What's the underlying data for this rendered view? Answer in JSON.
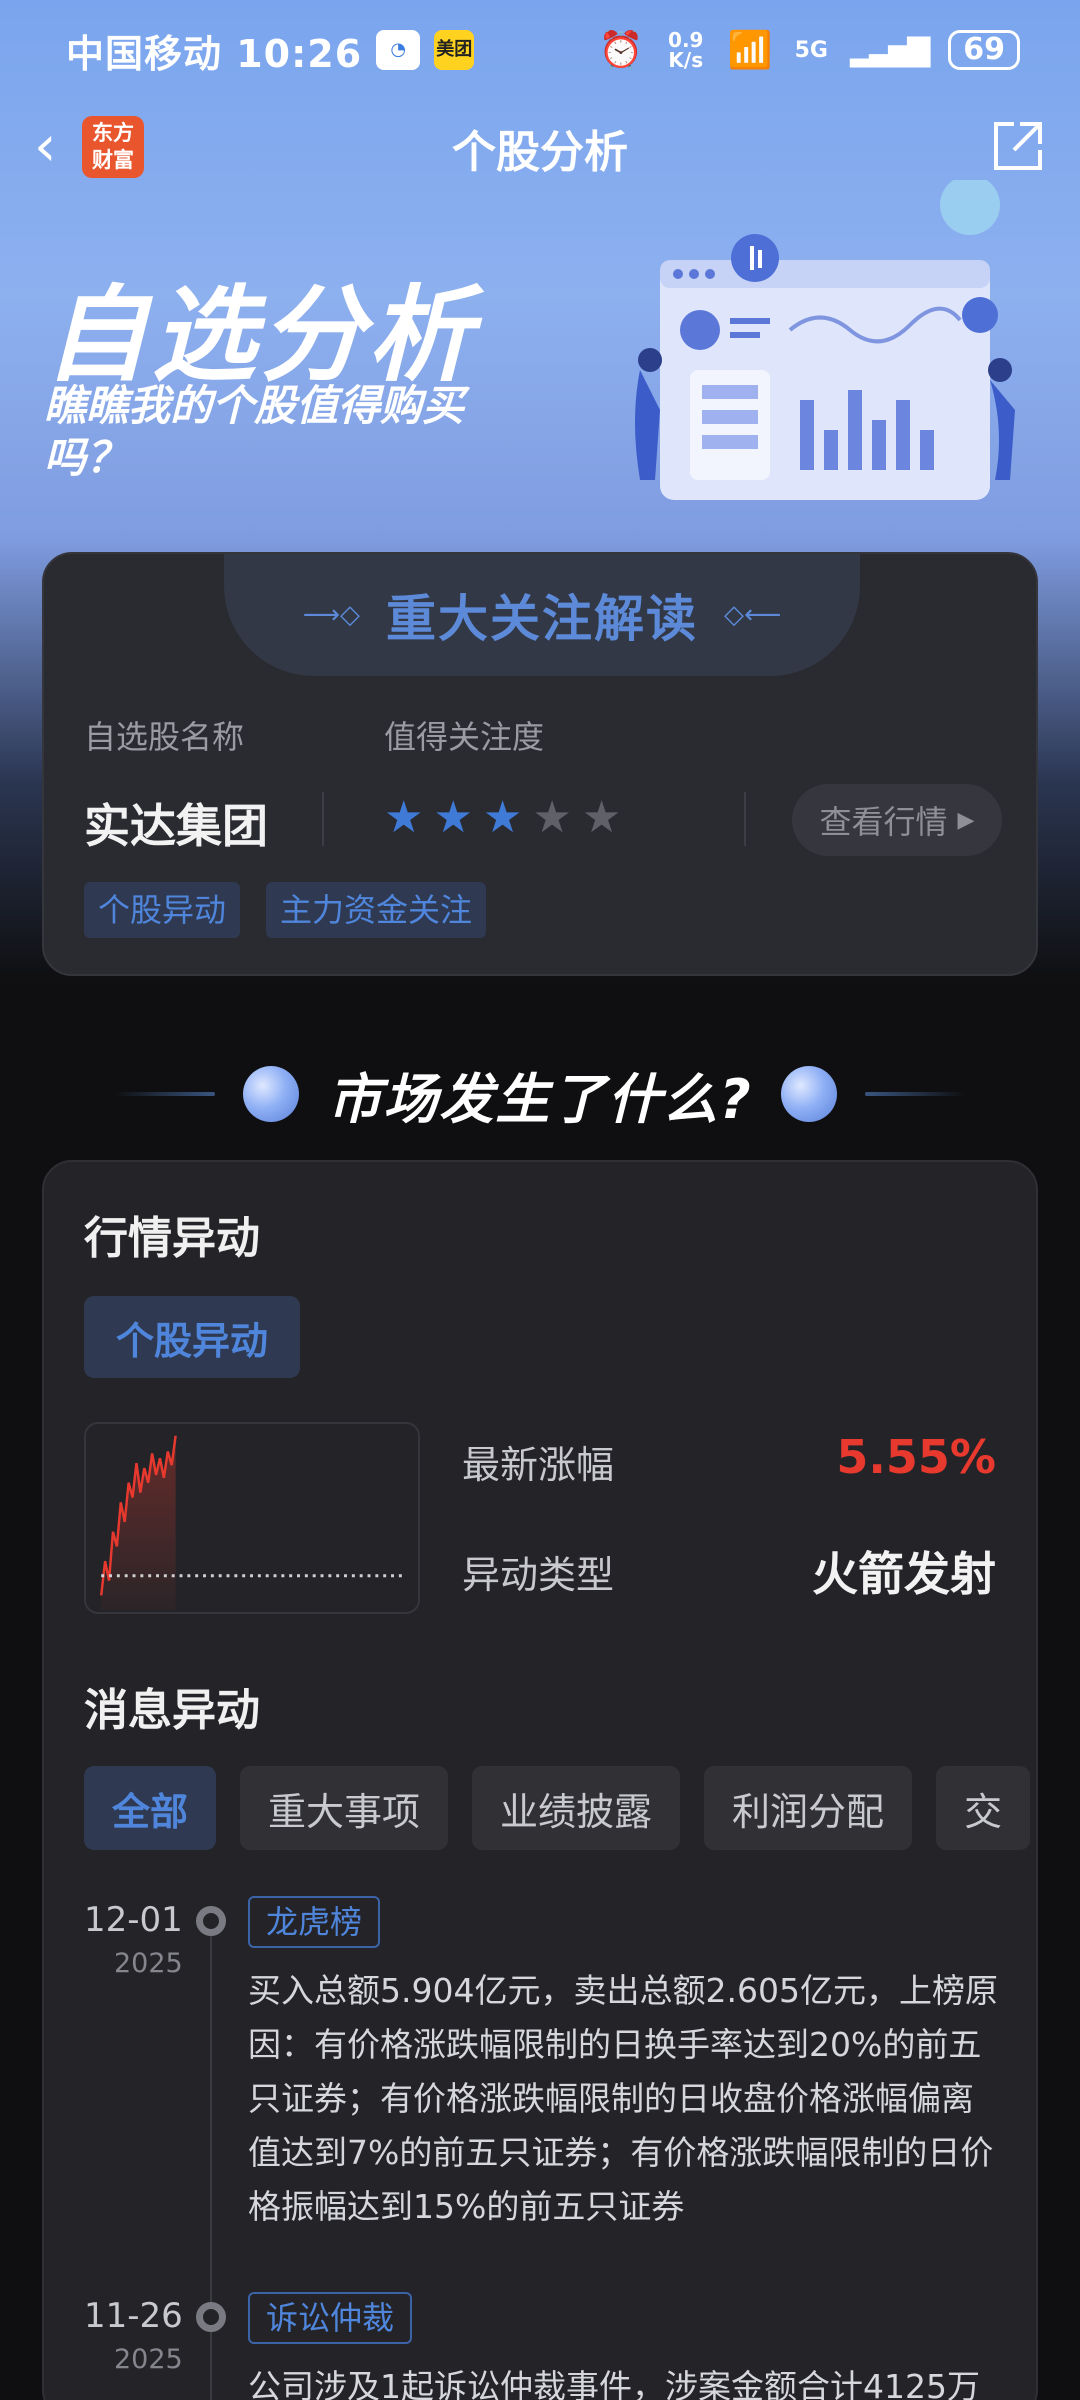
{
  "status_bar": {
    "carrier_time": "中国移动 10:26",
    "mini_app_2": "美团",
    "net_speed": "0.9 K/s",
    "signal": "5G",
    "battery": "69"
  },
  "nav": {
    "logo_text": "东方财富",
    "title": "个股分析"
  },
  "banner": {
    "title": "自选分析",
    "subtitle": "瞧瞧我的个股值得购买吗？"
  },
  "focus_card": {
    "tab_title": "重大关注解读",
    "name_label": "自选股名称",
    "attention_label": "值得关注度",
    "stock_name": "实达集团",
    "rating": 3,
    "rating_max": 5,
    "quote_button": "查看行情",
    "tags": [
      "个股异动",
      "主力资金关注"
    ]
  },
  "market_section": {
    "title": "市场发生了什么?"
  },
  "market_card": {
    "quote_title": "行情异动",
    "quote_chip": "个股异动",
    "latest_change_label": "最新涨幅",
    "latest_change_value": "5.55%",
    "anomaly_type_label": "异动类型",
    "anomaly_type_value": "火箭发射",
    "news_title": "消息异动",
    "filters": [
      "全部",
      "重大事项",
      "业绩披露",
      "利润分配",
      "交"
    ],
    "news": [
      {
        "date": "12-01",
        "year": "2025",
        "tag": "龙虎榜",
        "text": "买入总额5.904亿元，卖出总额2.605亿元，上榜原因：有价格涨跌幅限制的日换手率达到20%的前五只证券；有价格涨跌幅限制的日收盘价格涨幅偏离值达到7%的前五只证券；有价格涨跌幅限制的日价格振幅达到15%的前五只证券"
      },
      {
        "date": "11-26",
        "year": "2025",
        "tag": "诉讼仲裁",
        "text": "公司涉及1起诉讼仲裁事件，涉案金额合计4125万"
      }
    ]
  },
  "colors": {
    "accent_blue": "#4f86dc",
    "up_red": "#e8392f",
    "logo_orange": "#e9562d"
  }
}
